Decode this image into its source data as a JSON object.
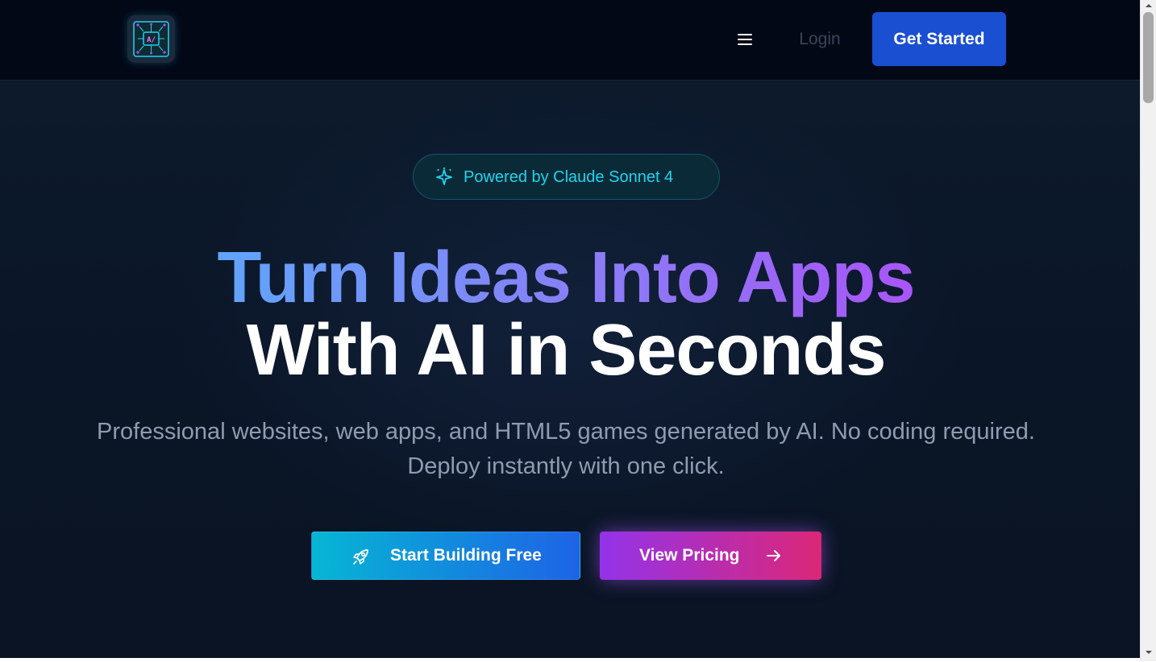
{
  "header": {
    "login_label": "Login",
    "get_started_label": "Get Started",
    "logo_icon": "ai-chip-icon",
    "menu_icon": "hamburger-menu-icon"
  },
  "hero": {
    "badge_text": "Powered by Claude Sonnet 4",
    "badge_icon": "sparkle-icon",
    "headline_line1": "Turn Ideas Into Apps",
    "headline_line2": "With AI in Seconds",
    "subtext": "Professional websites, web apps, and HTML5 games generated by AI. No coding required. Deploy instantly with one click.",
    "primary_button_label": "Start Building Free",
    "primary_button_icon": "rocket-icon",
    "secondary_button_label": "View Pricing",
    "secondary_button_icon": "arrow-right-icon"
  },
  "colors": {
    "header_bg": "#030817",
    "hero_bg": "#0b1628",
    "accent_blue": "#1a4fd1",
    "accent_cyan": "#22d3ee",
    "gradient_cyan": "#06b6d4",
    "gradient_purple": "#9333ea",
    "gradient_pink": "#db2777"
  }
}
